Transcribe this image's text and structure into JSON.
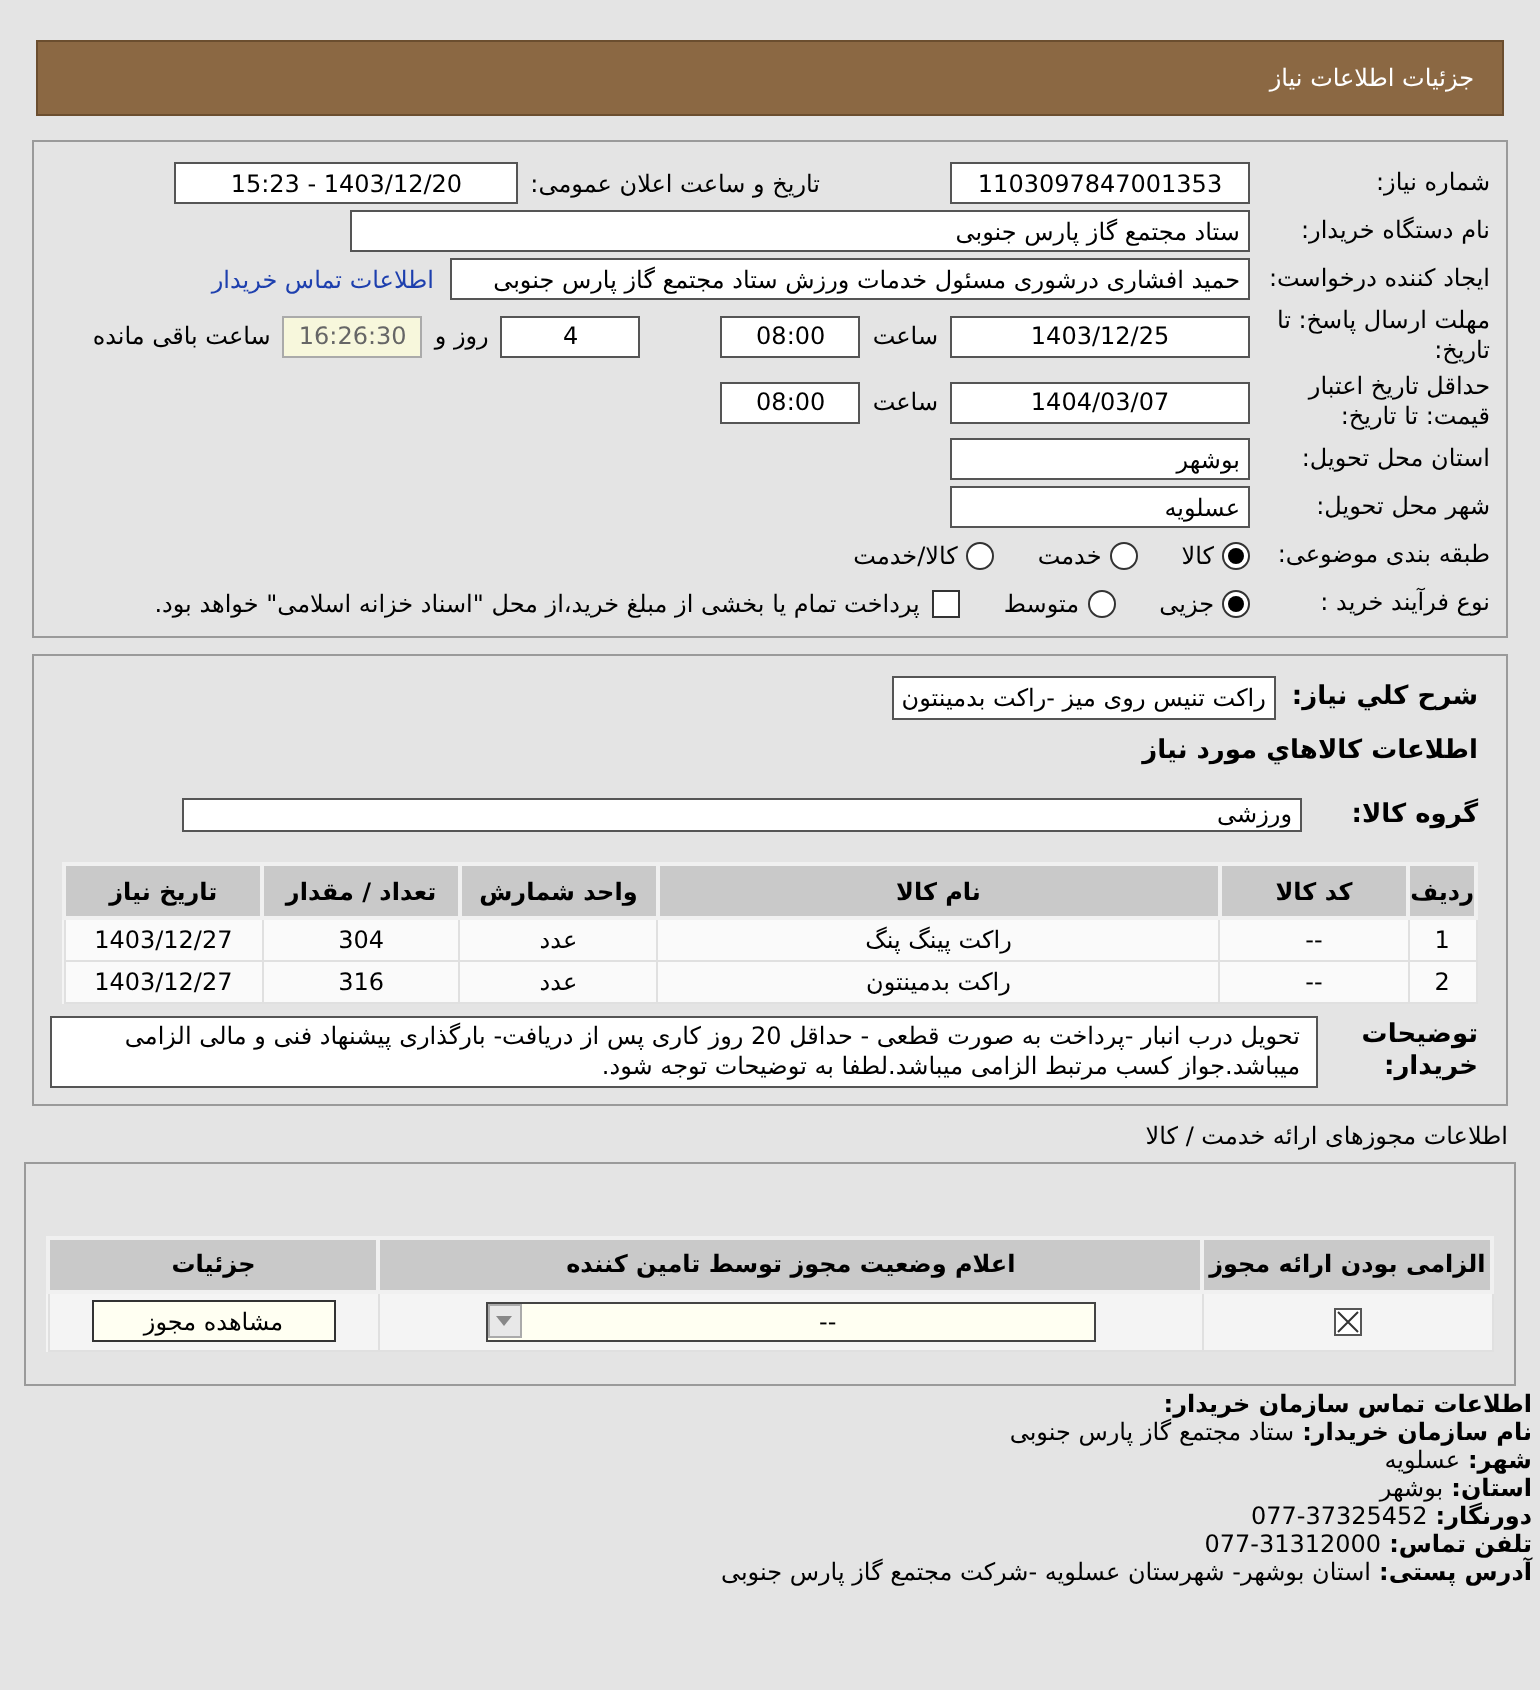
{
  "header": {
    "title": "جزئیات اطلاعات نیاز"
  },
  "details": {
    "need_number": {
      "label": "شماره نیاز:",
      "value": "1103097847001353"
    },
    "announce": {
      "label": "تاریخ و ساعت اعلان عمومی:",
      "value": "1403/12/20 - 15:23"
    },
    "buyer_org": {
      "label": "نام دستگاه خریدار:",
      "value": "ستاد مجتمع گاز پارس جنوبی"
    },
    "requester": {
      "label": "ایجاد کننده درخواست:",
      "value": "حمید افشاری درشوری مسئول خدمات ورزش ستاد مجتمع گاز پارس جنوبی",
      "link": "اطلاعات تماس خریدار"
    },
    "deadline": {
      "label": "مهلت ارسال پاسخ: تا تاریخ:",
      "date": "1403/12/25",
      "time_label": "ساعت",
      "time": "08:00",
      "days": "4",
      "days_label": "روز و",
      "remaining": "16:26:30",
      "remaining_label": "ساعت باقی مانده"
    },
    "validity": {
      "label": "حداقل تاریخ اعتبار قیمت: تا تاریخ:",
      "date": "1404/03/07",
      "time_label": "ساعت",
      "time": "08:00"
    },
    "province": {
      "label": "استان محل تحویل:",
      "value": "بوشهر"
    },
    "city": {
      "label": "شهر محل تحویل:",
      "value": "عسلویه"
    },
    "category": {
      "label": "طبقه بندی موضوعی:",
      "options": [
        {
          "label": "کالا",
          "selected": true
        },
        {
          "label": "خدمت",
          "selected": false
        },
        {
          "label": "کالا/خدمت",
          "selected": false
        }
      ]
    },
    "purchase_type": {
      "label": "نوع فرآیند خرید :",
      "options": [
        {
          "label": "جزیی",
          "selected": true
        },
        {
          "label": "متوسط",
          "selected": false
        }
      ],
      "payment": {
        "label": "پرداخت تمام یا بخشی از مبلغ خرید،از محل \"اسناد خزانه اسلامی\" خواهد بود.",
        "checked": false
      }
    }
  },
  "needs": {
    "summary": {
      "label": "شرح کلي نياز:",
      "value": "راکت تنیس روی میز -راکت بدمینتون"
    },
    "section_title": "اطلاعات کالاهاي مورد نياز",
    "group": {
      "label": "گروه کالا:",
      "value": "ورزشی"
    },
    "table": {
      "columns": [
        "ردیف",
        "کد کالا",
        "نام کالا",
        "واحد شمارش",
        "تعداد / مقدار",
        "تاریخ نیاز"
      ],
      "rows": [
        [
          "1",
          "--",
          "راکت پینگ پنگ",
          "عدد",
          "304",
          "1403/12/27"
        ],
        [
          "2",
          "--",
          "راکت بدمینتون",
          "عدد",
          "316",
          "1403/12/27"
        ]
      ]
    },
    "notes": {
      "label": "توضیحات خریدار:",
      "value": "تحویل درب انبار -پرداخت به صورت قطعی - حداقل 20 روز کاری پس از دریافت- بارگذاری پیشنهاد فنی و مالی الزامی میباشد.جواز کسب مرتبط الزامی میباشد.لطفا به توضیحات توجه شود."
    }
  },
  "licenses": {
    "title": "اطلاعات مجوزهای ارائه خدمت / کالا",
    "columns": [
      "الزامی بودن ارائه مجوز",
      "اعلام وضعیت مجوز توسط تامین کننده",
      "جزئیات"
    ],
    "rows": [
      {
        "required": true,
        "status": "--",
        "button": "مشاهده مجوز"
      }
    ]
  },
  "contact": {
    "title": "اطلاعات تماس سازمان خریدار:",
    "items": [
      {
        "label": "نام سازمان خریدار:",
        "value": "ستاد مجتمع گاز پارس جنوبی"
      },
      {
        "label": "شهر:",
        "value": "عسلویه"
      },
      {
        "label": "استان:",
        "value": "بوشهر"
      },
      {
        "label": "دورنگار:",
        "value": "077-37325452"
      },
      {
        "label": "تلفن تماس:",
        "value": "077-31312000"
      },
      {
        "label": "آدرس پستی:",
        "value": "استان بوشهر- شهرستان عسلویه -شرکت مجتمع گاز پارس جنوبی"
      }
    ]
  }
}
